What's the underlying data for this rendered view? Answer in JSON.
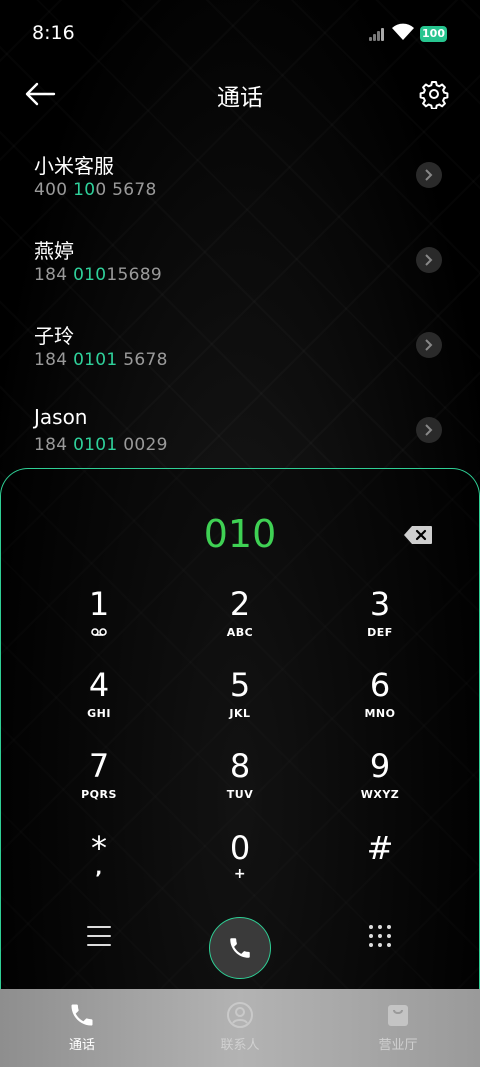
{
  "status_bar": {
    "time": "8:16",
    "battery": "100"
  },
  "header": {
    "title": "通话"
  },
  "contacts": [
    {
      "name": "小米客服",
      "number_parts": [
        "400",
        " ",
        "10",
        "0 5678"
      ],
      "highlight": [
        false,
        false,
        true,
        false
      ],
      "number": "400 100 5678"
    },
    {
      "name": "燕婷",
      "number_parts": [
        "184 ",
        "010",
        "15689"
      ],
      "number": "184 01015689"
    },
    {
      "name": "子玲",
      "number_parts": [
        "184 ",
        "0101",
        " 5678"
      ],
      "number": "184 0101 5678"
    },
    {
      "name": "Jason",
      "number_parts": [
        "184 ",
        "0101",
        " 0029"
      ],
      "number": "184 0101 0029"
    }
  ],
  "dialpad": {
    "input": "010",
    "keys": [
      {
        "digit": "1",
        "letters": "",
        "icon": "voicemail-icon"
      },
      {
        "digit": "2",
        "letters": "ABC"
      },
      {
        "digit": "3",
        "letters": "DEF"
      },
      {
        "digit": "4",
        "letters": "GHI"
      },
      {
        "digit": "5",
        "letters": "JKL"
      },
      {
        "digit": "6",
        "letters": "MNO"
      },
      {
        "digit": "7",
        "letters": "PQRS"
      },
      {
        "digit": "8",
        "letters": "TUV"
      },
      {
        "digit": "9",
        "letters": "WXYZ"
      },
      {
        "digit": "*",
        "letters": ","
      },
      {
        "digit": "0",
        "letters": "+"
      },
      {
        "digit": "#",
        "letters": ""
      }
    ]
  },
  "bottom_nav": [
    {
      "label": "通话",
      "icon": "phone-icon",
      "active": true
    },
    {
      "label": "联系人",
      "icon": "contact-icon",
      "active": false
    },
    {
      "label": "营业厅",
      "icon": "shop-bag-icon",
      "active": false
    }
  ],
  "colors": {
    "accent": "#2fd19b",
    "dial_text": "#3fd154",
    "battery": "#27c58f"
  }
}
